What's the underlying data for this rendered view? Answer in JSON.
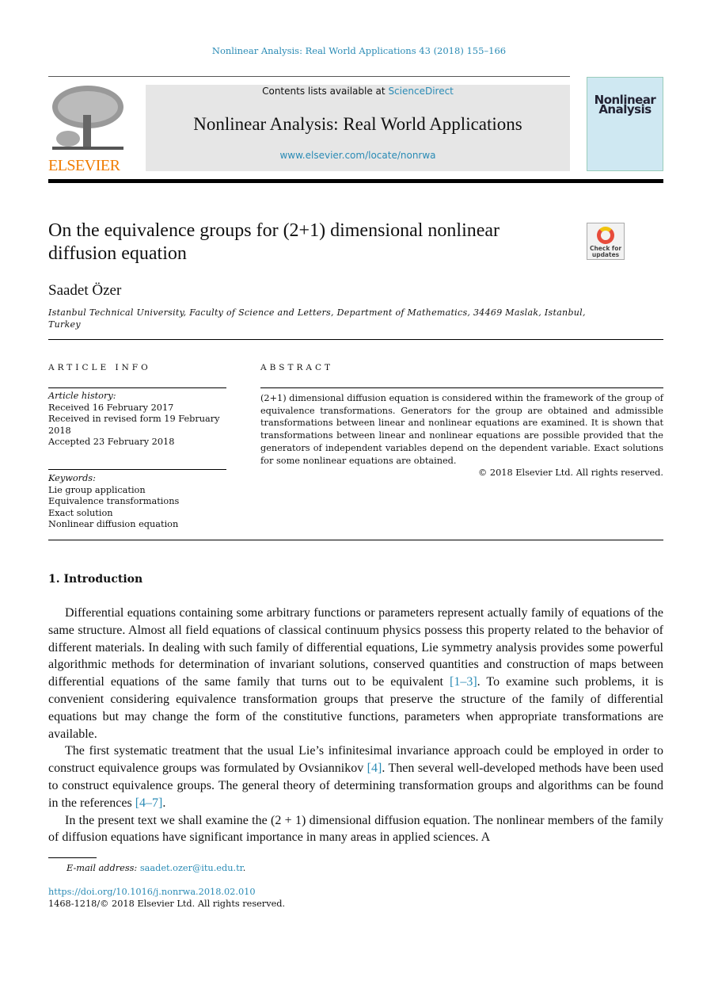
{
  "running_head": "Nonlinear Analysis: Real World Applications 43 (2018) 155–166",
  "masthead": {
    "publisher_logo": "ELSEVIER",
    "contents_prefix": "Contents lists available at ",
    "contents_link": "ScienceDirect",
    "journal_title": "Nonlinear Analysis: Real World Applications",
    "journal_url": "www.elsevier.com/locate/nonrwa",
    "cover_title": "Nonlinear Analysis"
  },
  "check_updates": "Check for updates",
  "title": "On the equivalence groups for (2+1) dimensional nonlinear diffusion equation",
  "author": "Saadet Özer",
  "affiliation": "Istanbul Technical University, Faculty of Science and Letters, Department of Mathematics, 34469 Maslak, Istanbul, Turkey",
  "article_info": {
    "heading": "ARTICLE INFO",
    "history_label": "Article history:",
    "history": [
      "Received 16 February 2017",
      "Received in revised form 19 February 2018",
      "Accepted 23 February 2018"
    ],
    "keywords_label": "Keywords:",
    "keywords": [
      "Lie group application",
      "Equivalence transformations",
      "Exact solution",
      "Nonlinear diffusion equation"
    ]
  },
  "abstract": {
    "heading": "ABSTRACT",
    "text": "(2+1) dimensional diffusion equation is considered within the framework of the group of equivalence transformations. Generators for the group are obtained and admissible transformations between linear and nonlinear equations are examined. It is shown that transformations between linear and nonlinear equations are possible provided that the generators of independent variables depend on the dependent variable. Exact solutions for some nonlinear equations are obtained.",
    "copyright": "© 2018 Elsevier Ltd. All rights reserved."
  },
  "section1": {
    "heading": "1. Introduction",
    "p1a": "Differential equations containing some arbitrary functions or parameters represent actually family of equations of the same structure. Almost all field equations of classical continuum physics possess this property related to the behavior of different materials. In dealing with such family of differential equations, Lie symmetry analysis provides some powerful algorithmic methods for determination of invariant solutions, conserved quantities and construction of maps between differential equations of the same family that turns out to be equivalent ",
    "ref1": "[1–3]",
    "p1b": ". To examine such problems, it is convenient considering equivalence transformation groups that preserve the structure of the family of differential equations but may change the form of the constitutive functions, parameters when appropriate transformations are available.",
    "p2a": "The first systematic treatment that the usual Lie’s infinitesimal invariance approach could be employed in order to construct equivalence groups was formulated by Ovsiannikov ",
    "ref2": "[4]",
    "p2b": ". Then several well-developed methods have been used to construct equivalence groups. The general theory of determining transformation groups and algorithms can be found in the references ",
    "ref3": "[4–7]",
    "p2c": ".",
    "p3": "In the present text we shall examine the (2 + 1) dimensional diffusion equation. The nonlinear members of the family of diffusion equations have significant importance in many areas in applied sciences. A"
  },
  "footnote": {
    "email_label": "E-mail address: ",
    "email": "saadet.ozer@itu.edu.tr",
    "doi": "https://doi.org/10.1016/j.nonrwa.2018.02.010",
    "issn": "1468-1218/© 2018 Elsevier Ltd. All rights reserved."
  },
  "colors": {
    "link": "#2a8bb5",
    "elsevier_orange": "#f07c00",
    "masthead_band": "#e6e6e6"
  }
}
